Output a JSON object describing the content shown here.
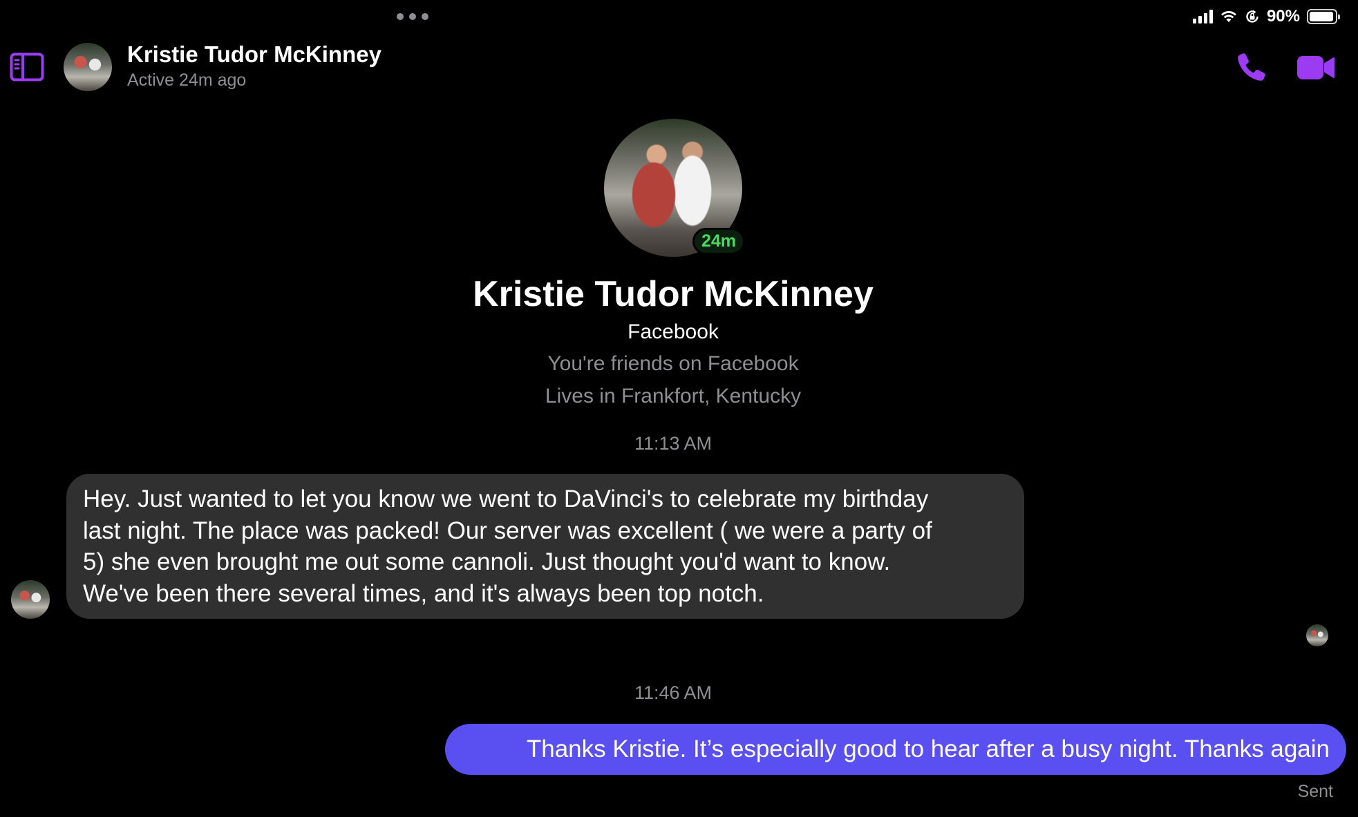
{
  "status_bar": {
    "battery": "90%"
  },
  "header": {
    "name": "Kristie Tudor McKinney",
    "status": "Active 24m ago"
  },
  "profile": {
    "name": "Kristie Tudor McKinney",
    "active_badge": "24m",
    "source": "Facebook",
    "friend_status": "You're friends on Facebook",
    "location": "Lives in Frankfort, Kentucky"
  },
  "messages": [
    {
      "timestamp": "11:13 AM",
      "direction": "incoming",
      "lines": [
        "Hey. Just wanted to let you know we went to DaVinci's to celebrate my birthday",
        "last night. The place was packed!  Our server was excellent ( we were a party of",
        "5) she even brought me out some cannoli. Just thought you'd want to know.",
        "We've been there several times, and it's always been top notch."
      ]
    },
    {
      "timestamp": "11:46 AM",
      "direction": "outgoing",
      "text": "Thanks Kristie. It’s especially good to hear after a busy night. Thanks again",
      "receipt": "Sent"
    }
  ],
  "colors": {
    "accent": "#9b3cf2",
    "outgoing_bubble": "#5a4ff0",
    "incoming_bubble": "#303030",
    "online": "#4bd964"
  },
  "icons": {
    "sidebar": "sidebar-toggle-icon",
    "call": "phone-icon",
    "video": "video-camera-icon",
    "menu": "more-dots-icon"
  }
}
